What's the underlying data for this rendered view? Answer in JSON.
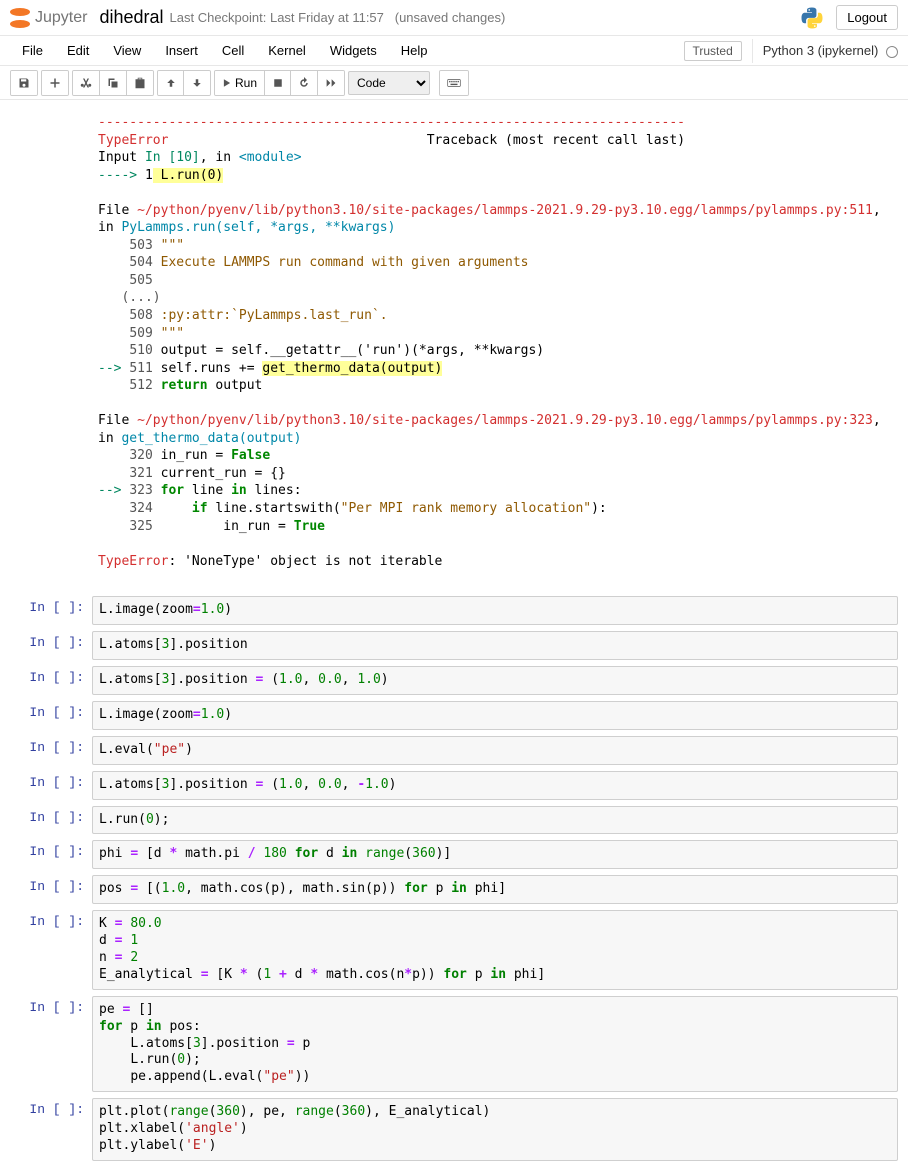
{
  "header": {
    "logo_text": "Jupyter",
    "notebook_name": "dihedral",
    "checkpoint": "Last Checkpoint: Last Friday at 11:57",
    "unsaved": "(unsaved changes)",
    "logout": "Logout"
  },
  "menu": {
    "file": "File",
    "edit": "Edit",
    "view": "View",
    "insert": "Insert",
    "cell": "Cell",
    "kernel": "Kernel",
    "widgets": "Widgets",
    "help": "Help",
    "trusted": "Trusted",
    "kernel_name": "Python 3 (ipykernel)"
  },
  "toolbar": {
    "run_label": "Run",
    "cell_type": "Code"
  },
  "traceback": {
    "dash": "---------------------------------------------------------------------------",
    "error_name": "TypeError",
    "tb_header": "Traceback (most recent call last)",
    "input_line": "Input ",
    "in_cell": "In [10]",
    "in_txt": ", in ",
    "module": "<module>",
    "arrow1": "----> ",
    "one": "1",
    "lrun": " L.run(",
    "zero": "0",
    "close": ")",
    "file1_prefix": "File ",
    "file1_path": "~/python/pyenv/lib/python3.10/site-packages/lammps-2021.9.29-py3.10.egg/lammps/pylammps.py:511",
    "file1_in": ", in ",
    "file1_func": "PyLammps.run(self, *args, **kwargs)",
    "l503": "    503",
    "l503_txt": " \"\"\"",
    "l504": "    504",
    "l504_txt": " Execute LAMMPS run command with given arguments",
    "l505": "    505",
    "dots": "   (...)",
    "l508": "    508",
    "l508_txt": " :py:attr:`PyLammps.last_run`.",
    "l509": "    509",
    "l509_txt": " \"\"\"",
    "l510": "    510",
    "l510_txt": " output = self.",
    "l510_func": "__getattr__",
    "l510_rest": "('run')(*args, **kwargs)",
    "arrow2": "--> ",
    "l511": "511",
    "l511_txt": " self.runs += ",
    "l511_hl": "get_thermo_data(output)",
    "l512": "    512",
    "l512_kw": " return",
    "l512_txt": " output",
    "file2_prefix": "File ",
    "file2_path": "~/python/pyenv/lib/python3.10/site-packages/lammps-2021.9.29-py3.10.egg/lammps/pylammps.py:323",
    "file2_in": ", in ",
    "file2_func": "get_thermo_data(output)",
    "l320": "    320",
    "l320_txt": " in_run = ",
    "l320_false": "False",
    "l321": "    321",
    "l321_txt": " current_run = {}",
    "arrow3": "--> ",
    "l323": "323",
    "l323_for": " for",
    "l323_txt": " line ",
    "l323_in": "in",
    "l323_rest": " lines:",
    "l324": "    324",
    "l324_if": "     if",
    "l324_txt": " line.startswith(",
    "l324_str": "\"Per MPI rank memory allocation\"",
    "l324_end": "):",
    "l325": "    325",
    "l325_txt": "         in_run = ",
    "l325_true": "True",
    "final_err": "TypeError",
    "final_msg": ": 'NoneType' object is not iterable"
  },
  "cells": {
    "p": "In [ ]:"
  }
}
